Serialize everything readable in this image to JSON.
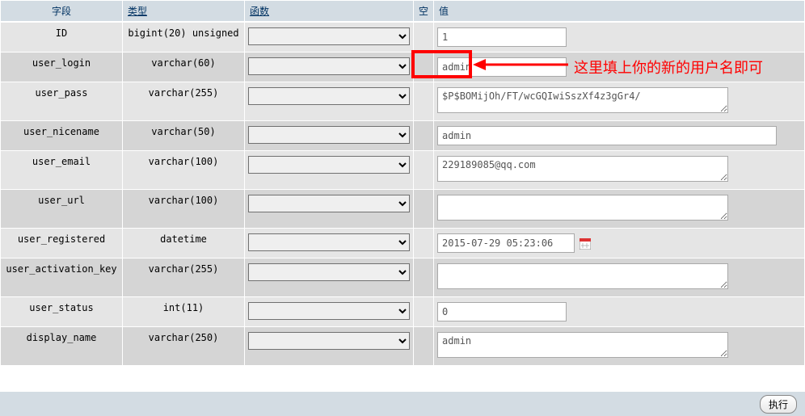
{
  "headers": {
    "field": "字段",
    "type": "类型",
    "func": "函数",
    "null": "空",
    "value": "值"
  },
  "rows": [
    {
      "field": "ID",
      "type": "bigint(20) unsigned",
      "input": "short",
      "value": "1"
    },
    {
      "field": "user_login",
      "type": "varchar(60)",
      "input": "short",
      "value": "admin"
    },
    {
      "field": "user_pass",
      "type": "varchar(255)",
      "input": "tarea",
      "value": "$P$BOMijOh/FT/wcGQIwiSszXf4z3gGr4/"
    },
    {
      "field": "user_nicename",
      "type": "varchar(50)",
      "input": "long",
      "value": "admin"
    },
    {
      "field": "user_email",
      "type": "varchar(100)",
      "input": "tarea",
      "value": "229189085@qq.com"
    },
    {
      "field": "user_url",
      "type": "varchar(100)",
      "input": "tarea",
      "value": ""
    },
    {
      "field": "user_registered",
      "type": "datetime",
      "input": "date",
      "value": "2015-07-29 05:23:06"
    },
    {
      "field": "user_activation_key",
      "type": "varchar(255)",
      "input": "tarea",
      "value": ""
    },
    {
      "field": "user_status",
      "type": "int(11)",
      "input": "short",
      "value": "0"
    },
    {
      "field": "display_name",
      "type": "varchar(250)",
      "input": "tarea",
      "value": "admin"
    }
  ],
  "annotation": "这里填上你的新的用户名即可",
  "exec_label": "执行",
  "col_widths": {
    "field": 150,
    "type": 150,
    "func": 200,
    "null": 20
  }
}
